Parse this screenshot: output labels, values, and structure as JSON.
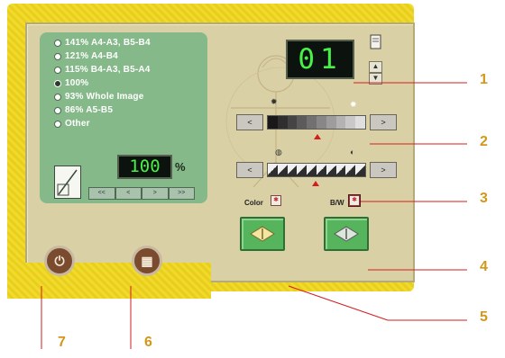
{
  "zoom_panel": {
    "options": [
      {
        "label": "141% A4-A3, B5-B4",
        "selected": false
      },
      {
        "label": "121% A4-B4",
        "selected": false
      },
      {
        "label": "115% B4-A3, B5-A4",
        "selected": false
      },
      {
        "label": "100%",
        "selected": true
      },
      {
        "label": "93% Whole Image",
        "selected": false
      },
      {
        "label": "86% A5-B5",
        "selected": false
      },
      {
        "label": "Other",
        "selected": false
      }
    ],
    "zoom_value": "100",
    "percent_sign": "%",
    "step_buttons": [
      "<<",
      "<",
      ">",
      ">>"
    ]
  },
  "copies_display": "01",
  "density": {
    "left_arrow": "<",
    "right_arrow": ">",
    "level": 0.5,
    "segments": 10
  },
  "contrast": {
    "left_arrow": "<",
    "right_arrow": ">",
    "level": 0.5,
    "segments": 10
  },
  "modes": {
    "color": {
      "label": "Color",
      "icon": "color-scan-icon"
    },
    "bw": {
      "label": "B/W",
      "icon": "bw-scan-icon"
    }
  },
  "bottom_buttons": {
    "power_icon": "power-icon",
    "scan_icon": "scanner-icon"
  },
  "callouts": [
    "1",
    "2",
    "3",
    "4",
    "5",
    "6",
    "7"
  ],
  "colors": {
    "accent_red": "#d31e1e",
    "callout": "#d1981a",
    "lcd_text": "#48f048",
    "panel_green": "#86b989"
  }
}
